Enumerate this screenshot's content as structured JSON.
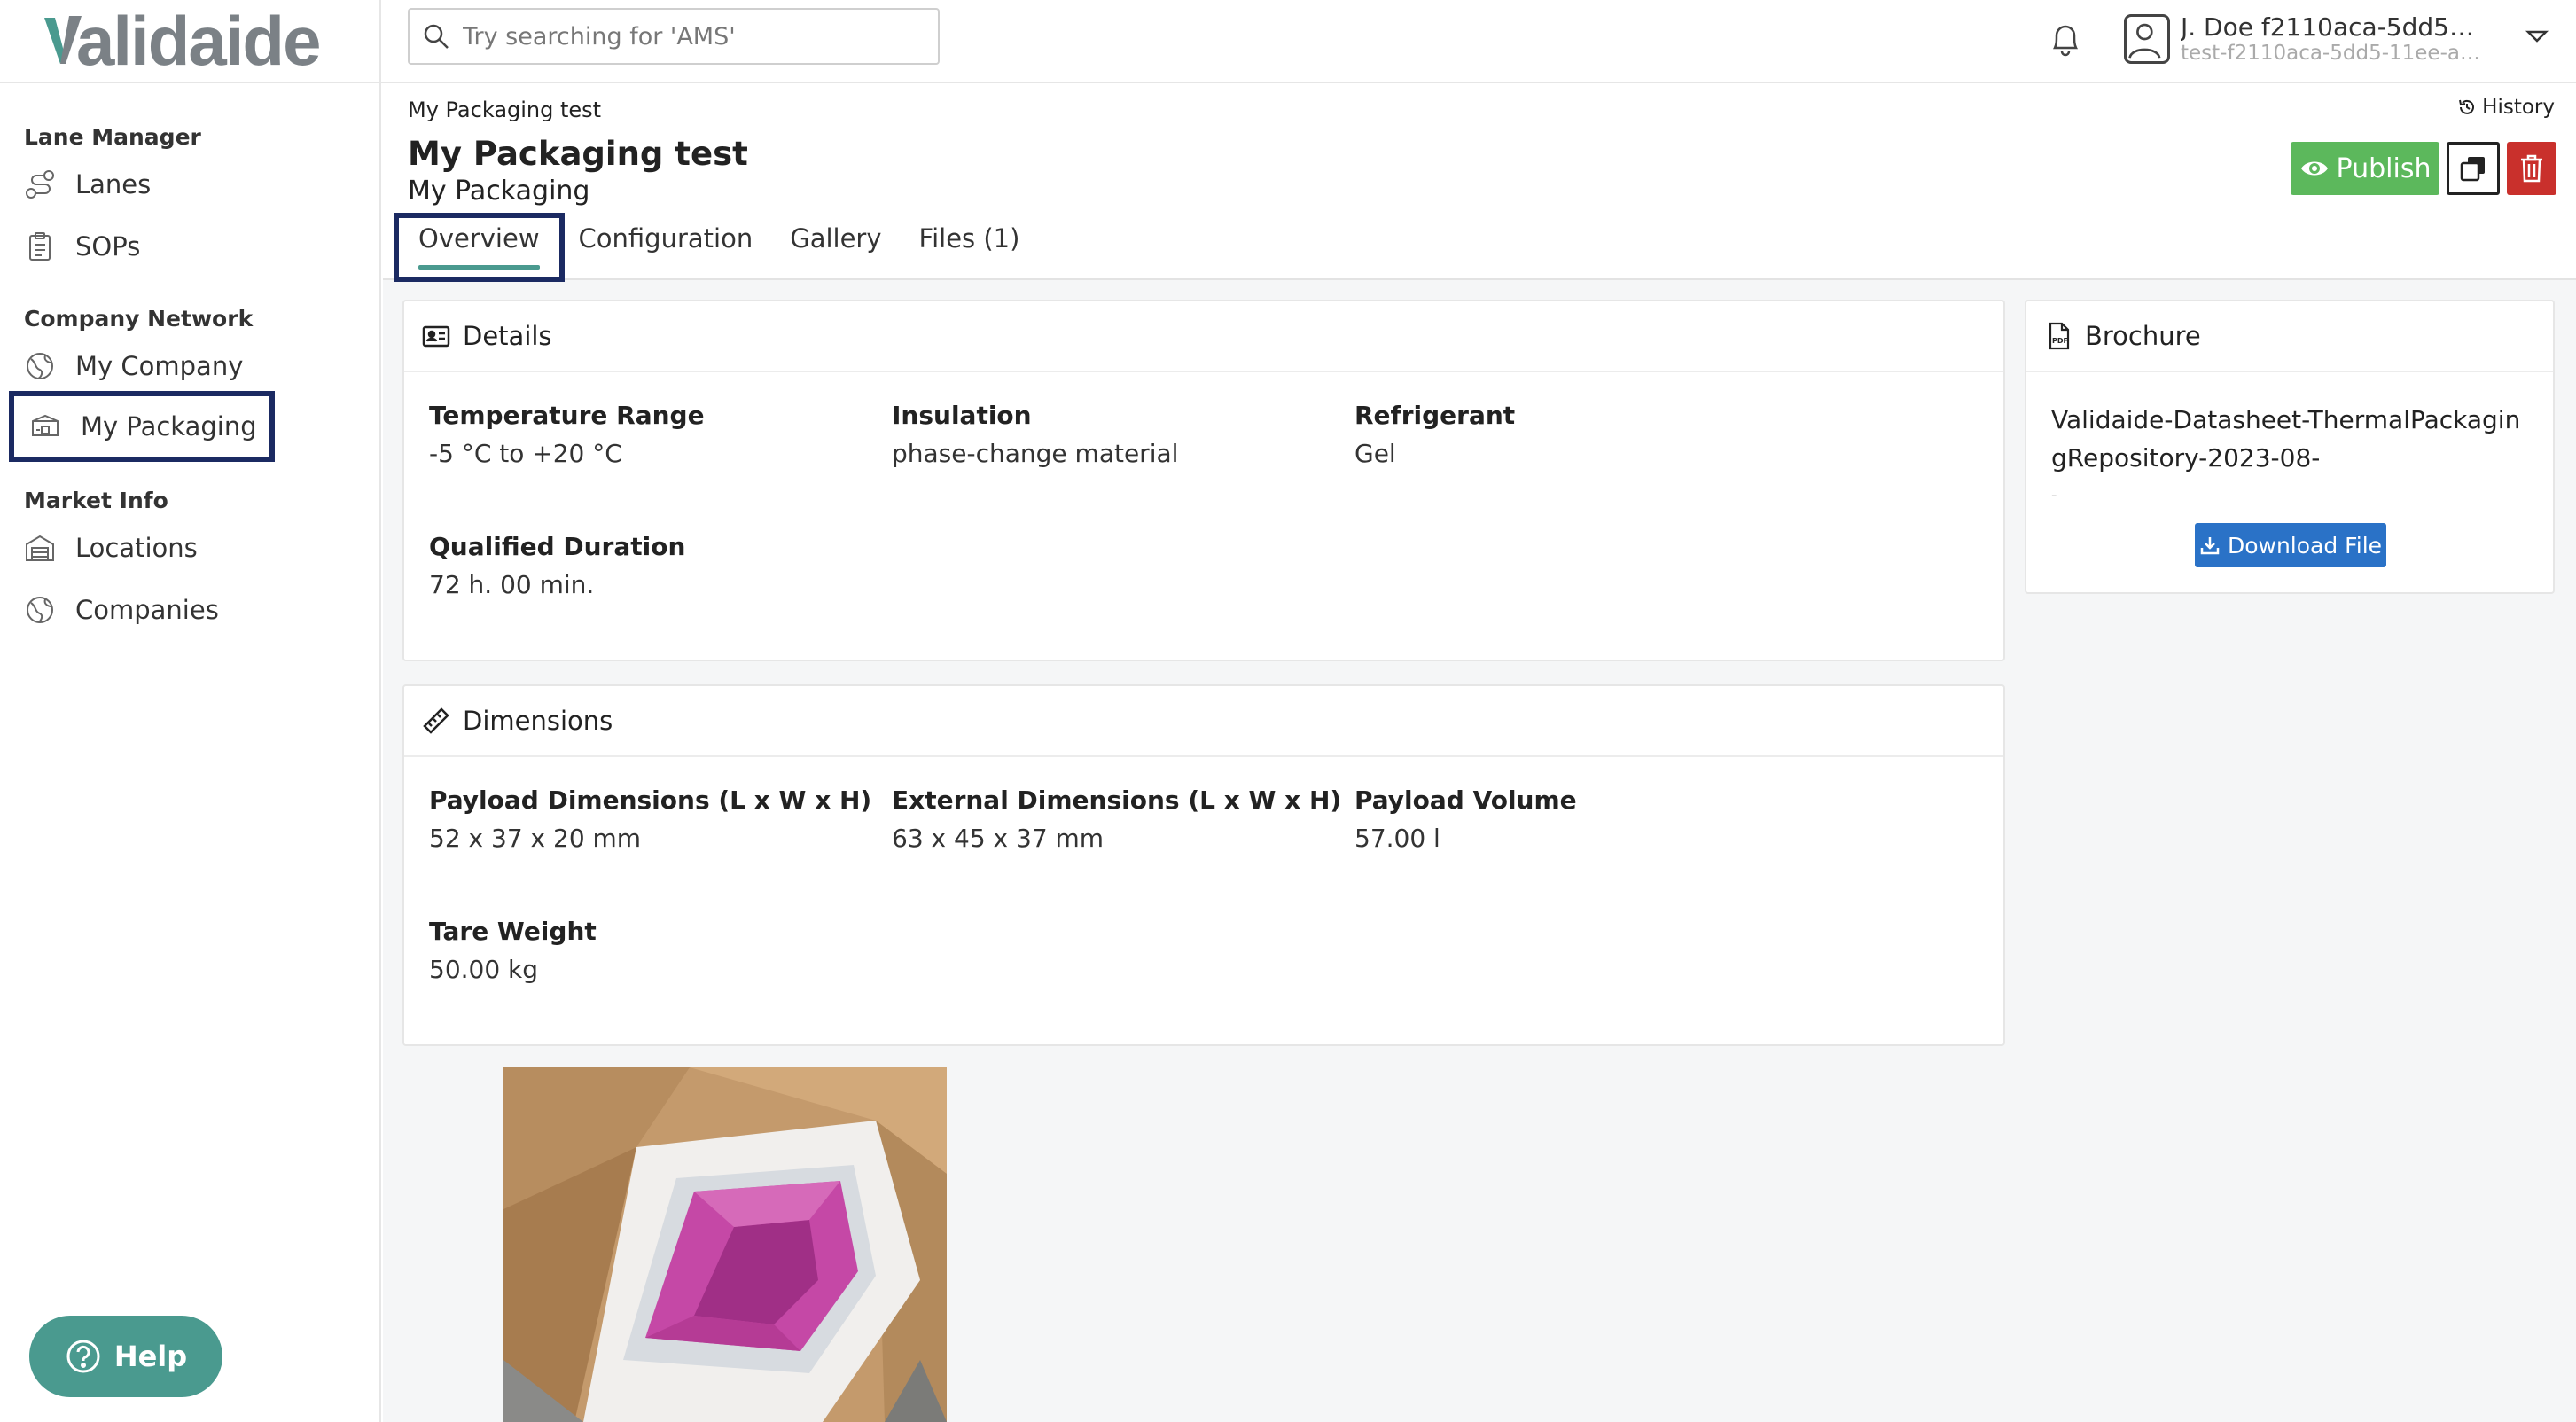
{
  "app": {
    "logo_text": "alidaide"
  },
  "search": {
    "placeholder": "Try searching for 'AMS'"
  },
  "user": {
    "name": "J. Doe f2110aca-5dd5-11...",
    "email": "test-f2110aca-5dd5-11ee-a46..."
  },
  "sidebar": {
    "sections": [
      {
        "title": "Lane Manager",
        "items": [
          {
            "label": "Lanes"
          },
          {
            "label": "SOPs"
          }
        ]
      },
      {
        "title": "Company Network",
        "items": [
          {
            "label": "My Company"
          },
          {
            "label": "My Packaging"
          }
        ]
      },
      {
        "title": "Market Info",
        "items": [
          {
            "label": "Locations"
          },
          {
            "label": "Companies"
          }
        ]
      }
    ],
    "help_label": "Help"
  },
  "page": {
    "breadcrumb": "My Packaging test",
    "history_label": "History",
    "title": "My Packaging test",
    "subtitle": "My Packaging",
    "publish_label": "Publish",
    "tabs": [
      {
        "label": "Overview"
      },
      {
        "label": "Configuration"
      },
      {
        "label": "Gallery"
      },
      {
        "label": "Files (1)"
      }
    ]
  },
  "details": {
    "title": "Details",
    "fields": [
      {
        "label": "Temperature Range",
        "value": "-5 °C to +20 °C"
      },
      {
        "label": "Insulation",
        "value": "phase-change material"
      },
      {
        "label": "Refrigerant",
        "value": "Gel"
      },
      {
        "label": "Qualified Duration",
        "value": "72 h. 00 min."
      }
    ]
  },
  "dimensions": {
    "title": "Dimensions",
    "fields": [
      {
        "label": "Payload Dimensions (L x W x H)",
        "value": "52 x 37 x 20 mm"
      },
      {
        "label": "External Dimensions (L x W x H)",
        "value": "63 x 45 x 37 mm"
      },
      {
        "label": "Payload Volume",
        "value": "57.00 l"
      },
      {
        "label": "Tare Weight",
        "value": "50.00 kg"
      }
    ]
  },
  "brochure": {
    "title": "Brochure",
    "file_name": "Validaide-Datasheet-ThermalPackagingRepository-2023-08-",
    "file_suffix": "-",
    "download_label": "Download File"
  },
  "colors": {
    "accent": "#4a9a8f",
    "publish": "#5cb85c",
    "delete": "#c9302c",
    "download": "#2a72c7",
    "highlight": "#1b2a62"
  }
}
